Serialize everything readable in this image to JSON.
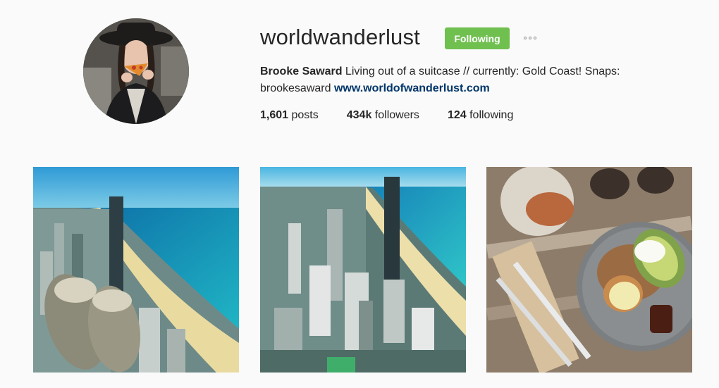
{
  "profile": {
    "username": "worldwanderlust",
    "follow_label": "Following",
    "more_icon": "ellipsis-icon",
    "full_name": "Brooke Saward",
    "bio_text": " Living out of a suitcase // currently: Gold Coast! Snaps: brookesaward ",
    "website": "www.worldofwanderlust.com",
    "stats": {
      "posts_count": "1,601",
      "posts_label": "posts",
      "followers_count": "434k",
      "followers_label": "followers",
      "following_count": "124",
      "following_label": "following"
    }
  },
  "colors": {
    "follow_green": "#70c050",
    "link_blue": "#003569",
    "background": "#fafafa"
  }
}
